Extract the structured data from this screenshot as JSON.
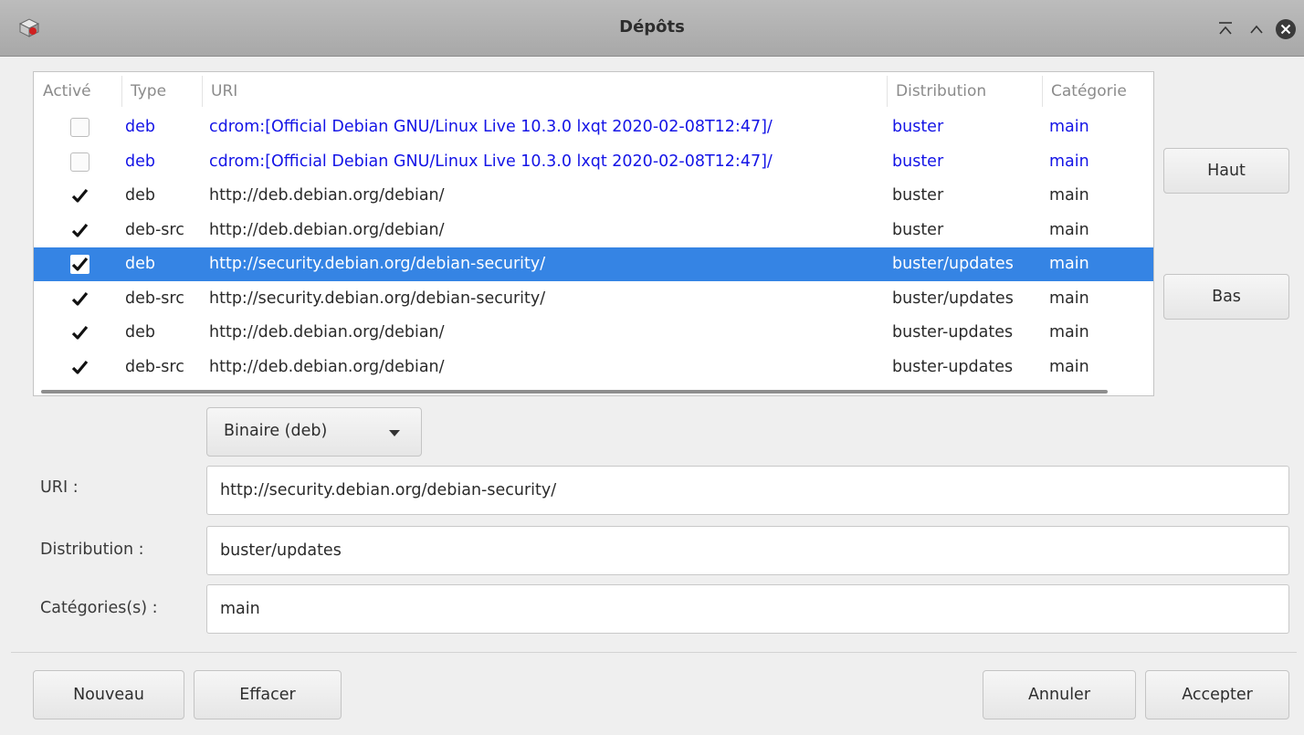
{
  "window": {
    "title": "Dépôts",
    "icons": [
      "package-icon",
      "minimize-icon",
      "maximize-icon",
      "close-icon"
    ]
  },
  "table": {
    "headers": {
      "enabled": "Activé",
      "type": "Type",
      "uri": "URI",
      "distribution": "Distribution",
      "categories": "Catégorie"
    },
    "rows": [
      {
        "enabled": false,
        "type": "deb",
        "uri": "cdrom:[Official Debian GNU/Linux Live 10.3.0 lxqt 2020-02-08T12:47]/",
        "distribution": "buster",
        "categories": "main",
        "style": "blue"
      },
      {
        "enabled": false,
        "type": "deb",
        "uri": "cdrom:[Official Debian GNU/Linux Live 10.3.0 lxqt 2020-02-08T12:47]/",
        "distribution": "buster",
        "categories": "main",
        "style": "blue"
      },
      {
        "enabled": true,
        "type": "deb",
        "uri": "http://deb.debian.org/debian/",
        "distribution": "buster",
        "categories": "main",
        "style": "normal"
      },
      {
        "enabled": true,
        "type": "deb-src",
        "uri": "http://deb.debian.org/debian/",
        "distribution": "buster",
        "categories": "main",
        "style": "normal"
      },
      {
        "enabled": true,
        "type": "deb",
        "uri": "http://security.debian.org/debian-security/",
        "distribution": "buster/updates",
        "categories": "main",
        "style": "selected"
      },
      {
        "enabled": true,
        "type": "deb-src",
        "uri": "http://security.debian.org/debian-security/",
        "distribution": "buster/updates",
        "categories": "main",
        "style": "normal"
      },
      {
        "enabled": true,
        "type": "deb",
        "uri": "http://deb.debian.org/debian/",
        "distribution": "buster-updates",
        "categories": "main",
        "style": "normal"
      },
      {
        "enabled": true,
        "type": "deb-src",
        "uri": "http://deb.debian.org/debian/",
        "distribution": "buster-updates",
        "categories": "main",
        "style": "normal"
      }
    ]
  },
  "side_buttons": {
    "up": "Haut",
    "down": "Bas"
  },
  "form": {
    "type_select": "Binaire (deb)",
    "uri_label": "URI :",
    "uri_value": "http://security.debian.org/debian-security/",
    "distribution_label": "Distribution :",
    "distribution_value": "buster/updates",
    "categories_label": "Catégories(s) :",
    "categories_value": "main"
  },
  "footer": {
    "new": "Nouveau",
    "delete": "Effacer",
    "cancel": "Annuler",
    "accept": "Accepter"
  },
  "colors": {
    "selection": "#3584e4",
    "cdrom_text": "#1414e6",
    "titlebar": "#b3b3b3"
  }
}
